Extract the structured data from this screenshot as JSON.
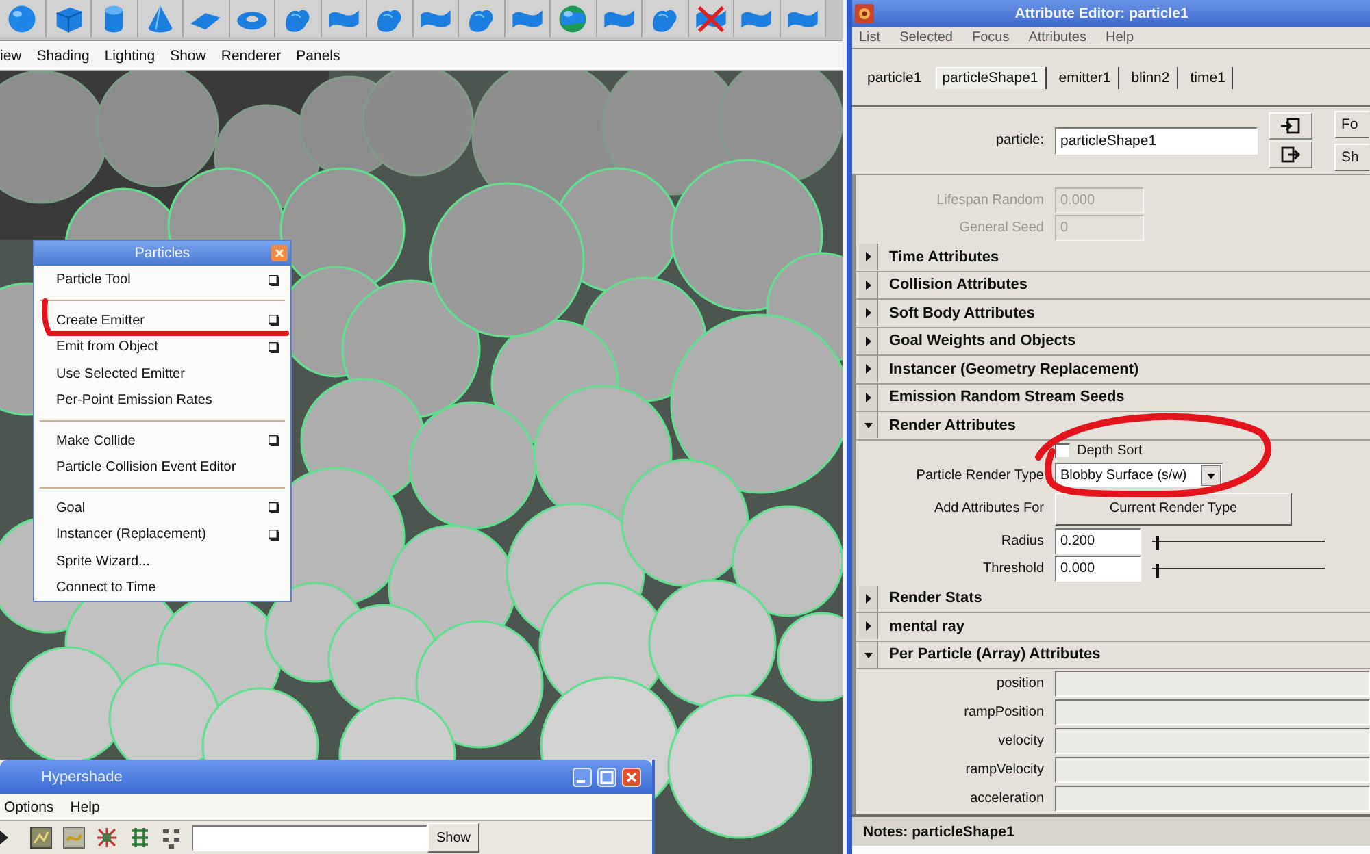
{
  "viewport": {
    "menu": [
      "iew",
      "Shading",
      "Lighting",
      "Show",
      "Renderer",
      "Panels"
    ]
  },
  "particles_window": {
    "title": "Particles",
    "items": [
      {
        "kind": "item",
        "label": "Particle Tool",
        "option_box": true
      },
      {
        "kind": "separator"
      },
      {
        "kind": "item",
        "label": "Create Emitter",
        "option_box": true
      },
      {
        "kind": "item",
        "label": "Emit from Object",
        "option_box": true
      },
      {
        "kind": "item",
        "label": "Use Selected Emitter",
        "option_box": false
      },
      {
        "kind": "item",
        "label": "Per-Point Emission Rates",
        "option_box": false
      },
      {
        "kind": "separator"
      },
      {
        "kind": "item",
        "label": "Make Collide",
        "option_box": true
      },
      {
        "kind": "item",
        "label": "Particle Collision Event Editor",
        "option_box": false
      },
      {
        "kind": "separator"
      },
      {
        "kind": "item",
        "label": "Goal",
        "option_box": true
      },
      {
        "kind": "item",
        "label": "Instancer (Replacement)",
        "option_box": true
      },
      {
        "kind": "item",
        "label": "Sprite Wizard...",
        "option_box": false
      },
      {
        "kind": "item",
        "label": "Connect to Time",
        "option_box": false
      }
    ]
  },
  "hypershade": {
    "title": "Hypershade",
    "menu": [
      "Options",
      "Help"
    ],
    "show_button": "Show"
  },
  "attribute_editor": {
    "title": "Attribute Editor: particle1",
    "menu": [
      "List",
      "Selected",
      "Focus",
      "Attributes",
      "Help"
    ],
    "tabs": [
      {
        "label": "particle1",
        "selected": false
      },
      {
        "label": "particleShape1",
        "selected": true
      },
      {
        "label": "emitter1",
        "selected": false
      },
      {
        "label": "blinn2",
        "selected": false
      },
      {
        "label": "time1",
        "selected": false
      }
    ],
    "node_field": {
      "label": "particle:",
      "value": "particleShape1"
    },
    "side_buttons": [
      "Fo",
      "Sh"
    ],
    "fields": [
      {
        "label": "Lifespan Random",
        "value": "0.000",
        "disabled": true
      },
      {
        "label": "General Seed",
        "value": "0",
        "disabled": true
      }
    ],
    "sections": [
      {
        "title": "Time Attributes",
        "expanded": false
      },
      {
        "title": "Collision Attributes",
        "expanded": false
      },
      {
        "title": "Soft Body Attributes",
        "expanded": false
      },
      {
        "title": "Goal Weights and Objects",
        "expanded": false
      },
      {
        "title": "Instancer (Geometry Replacement)",
        "expanded": false
      },
      {
        "title": "Emission Random Stream Seeds",
        "expanded": false
      },
      {
        "title": "Render Attributes",
        "expanded": true,
        "rows": [
          {
            "kind": "checkbox",
            "label": "Depth Sort",
            "checked": false
          },
          {
            "kind": "dropdown",
            "label": "Particle Render Type",
            "value": "Blobby Surface (s/w)"
          },
          {
            "kind": "button",
            "label": "Add Attributes For",
            "button": "Current Render Type"
          },
          {
            "kind": "slider",
            "label": "Radius",
            "value": "0.200",
            "level": 0.02
          },
          {
            "kind": "slider",
            "label": "Threshold",
            "value": "0.000",
            "level": 0.02
          }
        ]
      },
      {
        "title": "Render Stats",
        "expanded": false
      },
      {
        "title": "mental ray",
        "expanded": false
      },
      {
        "title": "Per Particle (Array) Attributes",
        "expanded": true,
        "rows": [
          {
            "kind": "field",
            "label": "position"
          },
          {
            "kind": "field",
            "label": "rampPosition"
          },
          {
            "kind": "field",
            "label": "velocity"
          },
          {
            "kind": "field",
            "label": "rampVelocity"
          },
          {
            "kind": "field",
            "label": "acceleration"
          }
        ]
      }
    ],
    "notes": "Notes: particleShape1"
  }
}
